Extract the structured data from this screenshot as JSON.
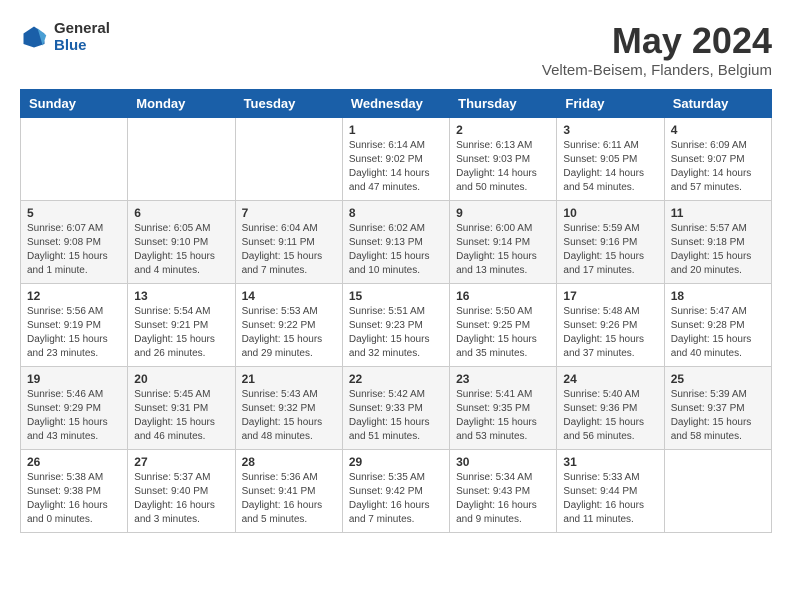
{
  "header": {
    "logo_general": "General",
    "logo_blue": "Blue",
    "month_title": "May 2024",
    "location": "Veltem-Beisem, Flanders, Belgium"
  },
  "days_of_week": [
    "Sunday",
    "Monday",
    "Tuesday",
    "Wednesday",
    "Thursday",
    "Friday",
    "Saturday"
  ],
  "weeks": [
    [
      {
        "day": "",
        "info": ""
      },
      {
        "day": "",
        "info": ""
      },
      {
        "day": "",
        "info": ""
      },
      {
        "day": "1",
        "info": "Sunrise: 6:14 AM\nSunset: 9:02 PM\nDaylight: 14 hours\nand 47 minutes."
      },
      {
        "day": "2",
        "info": "Sunrise: 6:13 AM\nSunset: 9:03 PM\nDaylight: 14 hours\nand 50 minutes."
      },
      {
        "day": "3",
        "info": "Sunrise: 6:11 AM\nSunset: 9:05 PM\nDaylight: 14 hours\nand 54 minutes."
      },
      {
        "day": "4",
        "info": "Sunrise: 6:09 AM\nSunset: 9:07 PM\nDaylight: 14 hours\nand 57 minutes."
      }
    ],
    [
      {
        "day": "5",
        "info": "Sunrise: 6:07 AM\nSunset: 9:08 PM\nDaylight: 15 hours\nand 1 minute."
      },
      {
        "day": "6",
        "info": "Sunrise: 6:05 AM\nSunset: 9:10 PM\nDaylight: 15 hours\nand 4 minutes."
      },
      {
        "day": "7",
        "info": "Sunrise: 6:04 AM\nSunset: 9:11 PM\nDaylight: 15 hours\nand 7 minutes."
      },
      {
        "day": "8",
        "info": "Sunrise: 6:02 AM\nSunset: 9:13 PM\nDaylight: 15 hours\nand 10 minutes."
      },
      {
        "day": "9",
        "info": "Sunrise: 6:00 AM\nSunset: 9:14 PM\nDaylight: 15 hours\nand 13 minutes."
      },
      {
        "day": "10",
        "info": "Sunrise: 5:59 AM\nSunset: 9:16 PM\nDaylight: 15 hours\nand 17 minutes."
      },
      {
        "day": "11",
        "info": "Sunrise: 5:57 AM\nSunset: 9:18 PM\nDaylight: 15 hours\nand 20 minutes."
      }
    ],
    [
      {
        "day": "12",
        "info": "Sunrise: 5:56 AM\nSunset: 9:19 PM\nDaylight: 15 hours\nand 23 minutes."
      },
      {
        "day": "13",
        "info": "Sunrise: 5:54 AM\nSunset: 9:21 PM\nDaylight: 15 hours\nand 26 minutes."
      },
      {
        "day": "14",
        "info": "Sunrise: 5:53 AM\nSunset: 9:22 PM\nDaylight: 15 hours\nand 29 minutes."
      },
      {
        "day": "15",
        "info": "Sunrise: 5:51 AM\nSunset: 9:23 PM\nDaylight: 15 hours\nand 32 minutes."
      },
      {
        "day": "16",
        "info": "Sunrise: 5:50 AM\nSunset: 9:25 PM\nDaylight: 15 hours\nand 35 minutes."
      },
      {
        "day": "17",
        "info": "Sunrise: 5:48 AM\nSunset: 9:26 PM\nDaylight: 15 hours\nand 37 minutes."
      },
      {
        "day": "18",
        "info": "Sunrise: 5:47 AM\nSunset: 9:28 PM\nDaylight: 15 hours\nand 40 minutes."
      }
    ],
    [
      {
        "day": "19",
        "info": "Sunrise: 5:46 AM\nSunset: 9:29 PM\nDaylight: 15 hours\nand 43 minutes."
      },
      {
        "day": "20",
        "info": "Sunrise: 5:45 AM\nSunset: 9:31 PM\nDaylight: 15 hours\nand 46 minutes."
      },
      {
        "day": "21",
        "info": "Sunrise: 5:43 AM\nSunset: 9:32 PM\nDaylight: 15 hours\nand 48 minutes."
      },
      {
        "day": "22",
        "info": "Sunrise: 5:42 AM\nSunset: 9:33 PM\nDaylight: 15 hours\nand 51 minutes."
      },
      {
        "day": "23",
        "info": "Sunrise: 5:41 AM\nSunset: 9:35 PM\nDaylight: 15 hours\nand 53 minutes."
      },
      {
        "day": "24",
        "info": "Sunrise: 5:40 AM\nSunset: 9:36 PM\nDaylight: 15 hours\nand 56 minutes."
      },
      {
        "day": "25",
        "info": "Sunrise: 5:39 AM\nSunset: 9:37 PM\nDaylight: 15 hours\nand 58 minutes."
      }
    ],
    [
      {
        "day": "26",
        "info": "Sunrise: 5:38 AM\nSunset: 9:38 PM\nDaylight: 16 hours\nand 0 minutes."
      },
      {
        "day": "27",
        "info": "Sunrise: 5:37 AM\nSunset: 9:40 PM\nDaylight: 16 hours\nand 3 minutes."
      },
      {
        "day": "28",
        "info": "Sunrise: 5:36 AM\nSunset: 9:41 PM\nDaylight: 16 hours\nand 5 minutes."
      },
      {
        "day": "29",
        "info": "Sunrise: 5:35 AM\nSunset: 9:42 PM\nDaylight: 16 hours\nand 7 minutes."
      },
      {
        "day": "30",
        "info": "Sunrise: 5:34 AM\nSunset: 9:43 PM\nDaylight: 16 hours\nand 9 minutes."
      },
      {
        "day": "31",
        "info": "Sunrise: 5:33 AM\nSunset: 9:44 PM\nDaylight: 16 hours\nand 11 minutes."
      },
      {
        "day": "",
        "info": ""
      }
    ]
  ]
}
